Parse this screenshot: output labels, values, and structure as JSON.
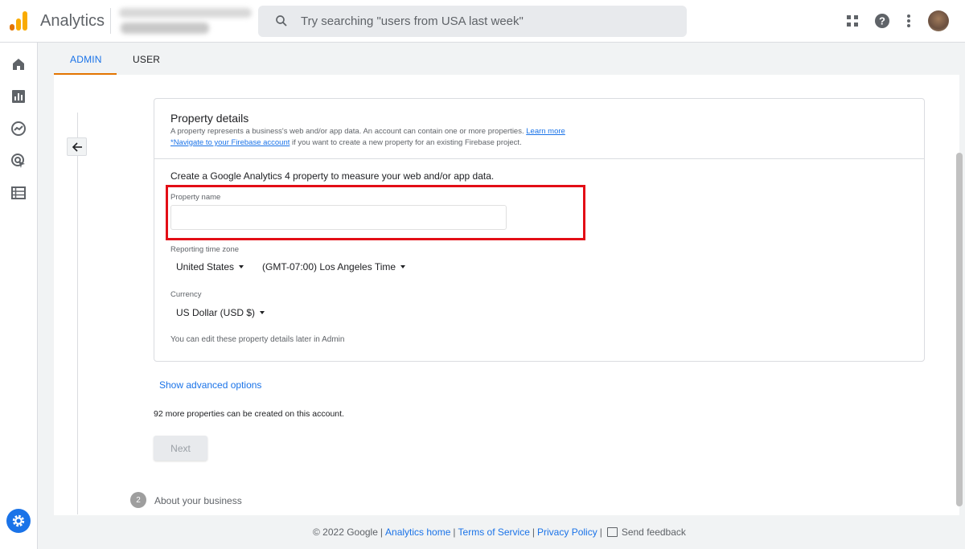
{
  "header": {
    "app_title": "Analytics",
    "search_placeholder": "Try searching \"users from USA last week\""
  },
  "tabs": [
    {
      "label": "ADMIN",
      "active": true
    },
    {
      "label": "USER",
      "active": false
    }
  ],
  "card": {
    "title": "Property details",
    "desc_line1": "A property represents a business's web and/or app data. An account can contain one or more properties.",
    "learn_more": "Learn more",
    "firebase_link": "*Navigate to your Firebase account",
    "desc_line2_suffix": " if you want to create a new property for an existing Firebase project.",
    "create_text": "Create a Google Analytics 4 property to measure your web and/or app data.",
    "property_name_label": "Property name",
    "property_name_value": "",
    "timezone_label": "Reporting time zone",
    "country": "United States",
    "timezone": "(GMT-07:00) Los Angeles Time",
    "currency_label": "Currency",
    "currency": "US Dollar (USD $)",
    "note": "You can edit these property details later in Admin"
  },
  "advanced_options": "Show advanced options",
  "more_properties": "92 more properties can be created on this account.",
  "next_label": "Next",
  "next_step": {
    "number": "2",
    "label": "About your business"
  },
  "footer": {
    "copyright": "© 2022 Google",
    "analytics_home": "Analytics home",
    "terms": "Terms of Service",
    "privacy": "Privacy Policy",
    "feedback": "Send feedback",
    "separator": "|"
  },
  "colors": {
    "accent": "#1a73e8",
    "tab_underline": "#e37400",
    "highlight": "#e30e16"
  },
  "icons": [
    "analytics-logo-icon",
    "search-icon",
    "apps-grid-icon",
    "help-icon",
    "more-vert-icon",
    "home-icon",
    "reports-icon",
    "explore-icon",
    "advertising-icon",
    "configure-icon",
    "settings-gear-icon",
    "arrow-back-icon",
    "feedback-icon"
  ]
}
